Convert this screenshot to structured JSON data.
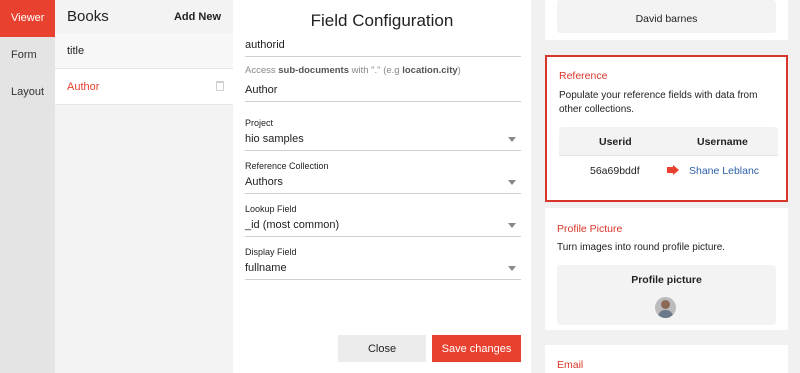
{
  "rail": {
    "tabs": [
      "Viewer",
      "Form",
      "Layout"
    ]
  },
  "list": {
    "title": "Books",
    "add_new": "Add New",
    "items": [
      "title",
      "Author"
    ]
  },
  "config": {
    "title": "Field Configuration",
    "field_name": "authorid",
    "hint_prefix": "Access ",
    "hint_bold1": "sub-documents",
    "hint_mid": " with \".\" (e.g ",
    "hint_bold2": "location.city",
    "hint_suffix": ")",
    "display_label": "Author",
    "project_label": "Project",
    "project_value": "hio samples",
    "collection_label": "Reference Collection",
    "collection_value": "Authors",
    "lookup_label": "Lookup Field",
    "lookup_value": "_id (most common)",
    "display_field_label": "Display Field",
    "display_field_value": "fullname",
    "close_label": "Close",
    "save_label": "Save changes"
  },
  "preview": {
    "top_card_text": "David barnes",
    "reference": {
      "title": "Reference",
      "desc": "Populate your reference fields with data from other collections.",
      "col1": "Userid",
      "col2": "Username",
      "val1": "56a69bddf",
      "val2": "Shane Leblanc"
    },
    "profile": {
      "title": "Profile Picture",
      "desc": "Turn images into round profile picture.",
      "inner_title": "Profile picture"
    },
    "email": {
      "title": "Email"
    }
  },
  "colors": {
    "accent": "#e8412f",
    "link": "#2d5fa8"
  }
}
